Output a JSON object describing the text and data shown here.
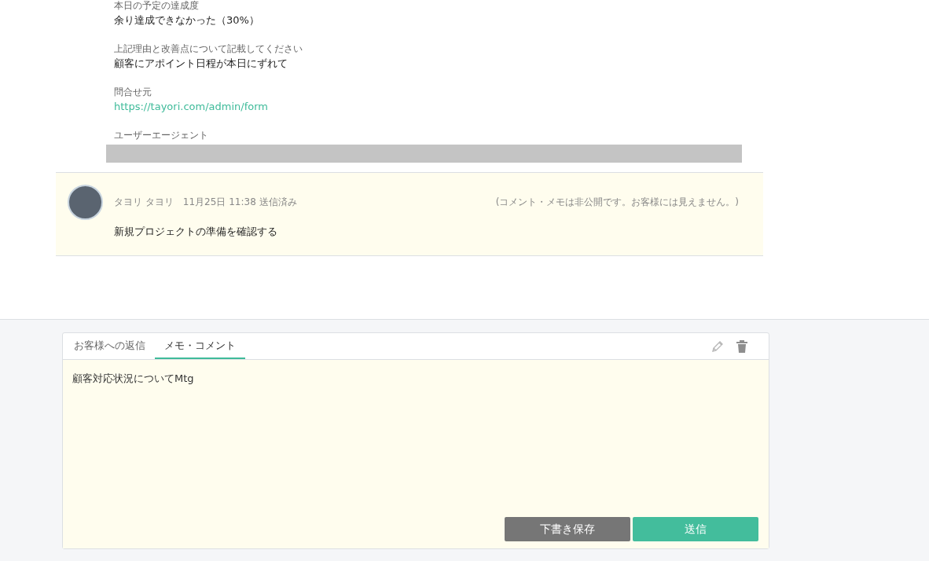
{
  "fields": [
    {
      "label": "本日の予定の達成度",
      "kind": "text",
      "value": "余り達成できなかった（30%）"
    },
    {
      "label": "上記理由と改善点について記載してください",
      "kind": "text",
      "value": "顧客にアポイント日程が本日にずれて"
    },
    {
      "label": "問合せ元",
      "kind": "link",
      "value": "https://tayori.com/admin/form"
    },
    {
      "label": "ユーザーエージェント",
      "kind": "redacted"
    }
  ],
  "comment": {
    "author": "タヨリ タヨリ",
    "time": "11月25日 11:38 送信済み",
    "notice": "(コメント・メモは非公開です。お客様には見えません。)",
    "body": "新規プロジェクトの準備を確認する"
  },
  "editor": {
    "tabs": [
      {
        "label": "お客様への返信",
        "selected": false
      },
      {
        "label": "メモ・コメント",
        "selected": true
      }
    ],
    "value": "顧客対応状況についてMtg",
    "buttons": [
      {
        "label": "下書き保存",
        "kind": "secondary"
      },
      {
        "label": "送信",
        "kind": "primary"
      }
    ]
  }
}
